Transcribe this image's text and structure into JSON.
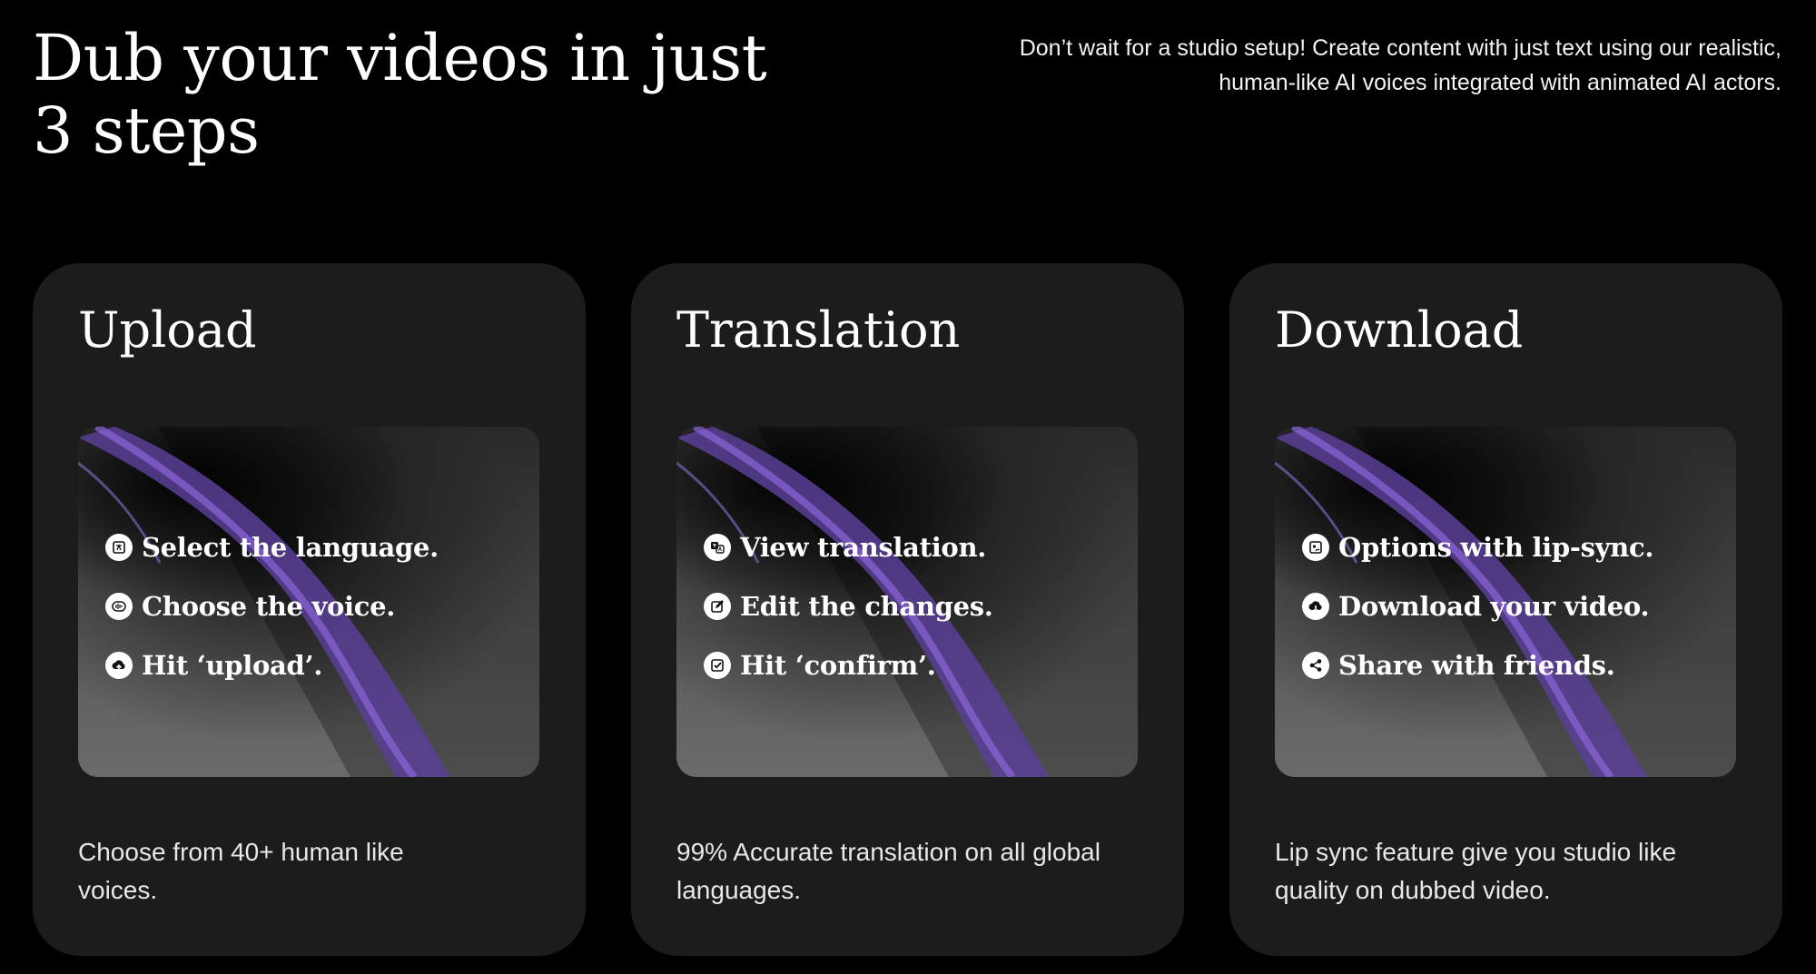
{
  "header": {
    "title_line1": "Dub your videos in just",
    "title_line2": "3 steps",
    "intro_line1": "Don’t wait for a studio setup! Create content with just text using our realistic,",
    "intro_line2": "human-like AI voices integrated with animated AI actors."
  },
  "cards": [
    {
      "title": "Upload",
      "steps": [
        {
          "icon": "language-icon",
          "label": "Select the language."
        },
        {
          "icon": "voice-icon",
          "label": "Choose the voice."
        },
        {
          "icon": "upload-icon",
          "label": "Hit ‘upload’."
        }
      ],
      "desc_line1": "Choose from 40+ human like",
      "desc_line2": "voices."
    },
    {
      "title": "Translation",
      "steps": [
        {
          "icon": "translate-icon",
          "label": "View translation."
        },
        {
          "icon": "edit-icon",
          "label": "Edit the changes."
        },
        {
          "icon": "confirm-icon",
          "label": "Hit ‘confirm’."
        }
      ],
      "desc_line1": "99% Accurate translation on all global",
      "desc_line2": "languages."
    },
    {
      "title": "Download",
      "steps": [
        {
          "icon": "lip-sync-icon",
          "label": "Options with lip-sync."
        },
        {
          "icon": "download-icon",
          "label": "Download your video."
        },
        {
          "icon": "share-icon",
          "label": "Share with friends."
        }
      ],
      "desc_line1": "Lip sync feature give you studio like",
      "desc_line2": "quality on dubbed video."
    }
  ],
  "colors": {
    "background": "#000000",
    "card": "#1c1c1c",
    "accent": "#7a55c8",
    "text": "#ffffff"
  }
}
